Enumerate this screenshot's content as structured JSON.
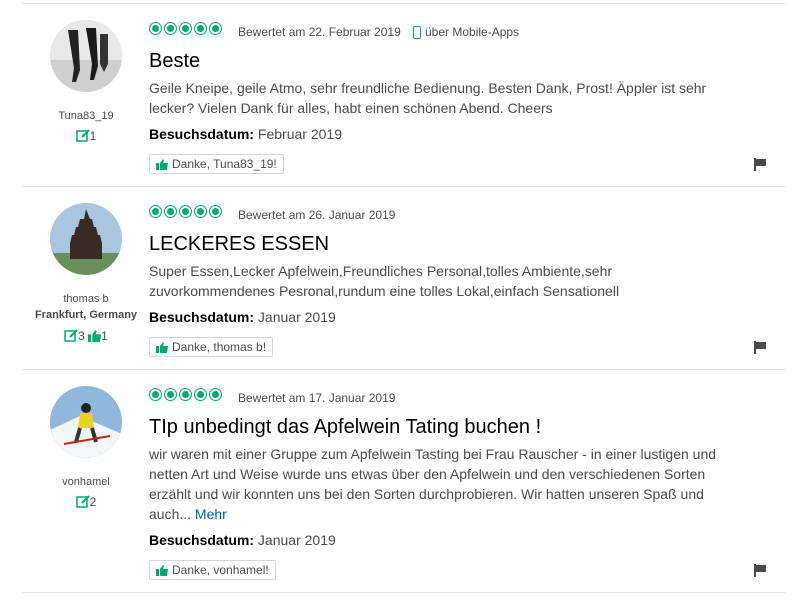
{
  "reviews": [
    {
      "username": "Tuna83_19",
      "location": "",
      "contributions": "1",
      "helpful_votes": "",
      "reviewed_text": "Bewertet am 22. Februar 2019",
      "via_mobile": "über Mobile-Apps",
      "rating": 5,
      "title": "Beste",
      "body": "Geile Kneipe, geile Atmo, sehr freundliche Bedienung. Besten Dank, Prost! Äppler ist sehr lecker? Vielen Dank für alles, habt einen schönen Abend. Cheers",
      "more_label": "",
      "visit_label": "Besuchsdatum:",
      "visit_date": "Februar 2019",
      "thanks_label": "Danke, Tuna83_19!"
    },
    {
      "username": "thomas b",
      "location": "Frankfurt, Germany",
      "contributions": "3",
      "helpful_votes": "1",
      "reviewed_text": "Bewertet am 26. Januar 2019",
      "via_mobile": "",
      "rating": 5,
      "title": "LECKERES ESSEN",
      "body": "Super Essen,Lecker Apfelwein,Freundliches Personal,tolles Ambiente,sehr zuvorkommendenes Pesronal,rundum eine tolles Lokal,einfach Sensationell",
      "more_label": "",
      "visit_label": "Besuchsdatum:",
      "visit_date": "Januar 2019",
      "thanks_label": "Danke, thomas b!"
    },
    {
      "username": "vonhamel",
      "location": "",
      "contributions": "2",
      "helpful_votes": "",
      "reviewed_text": "Bewertet am 17. Januar 2019",
      "via_mobile": "",
      "rating": 5,
      "title": "TIp unbedingt das Apfelwein Tating buchen !",
      "body": "wir waren mit einer Gruppe zum Apfelwein Tasting bei Frau Rauscher - in einer lustigen und netten Art und Weise wurde uns etwas über den Apfelwein und den verschiedenen Sorten erzählt und wir konnten uns bei den Sorten durchprobieren. Wir hatten unseren Spaß und auch...",
      "more_label": "Mehr",
      "visit_label": "Besuchsdatum:",
      "visit_date": "Januar 2019",
      "thanks_label": "Danke, vonhamel!"
    }
  ],
  "colors": {
    "accent": "#00aa6c",
    "link": "#006699"
  },
  "icons": [
    "bubble-rating-icon",
    "mobile-phone-icon",
    "contribution-icon",
    "helpful-thumb-icon",
    "thumbs-up-icon",
    "flag-icon"
  ]
}
